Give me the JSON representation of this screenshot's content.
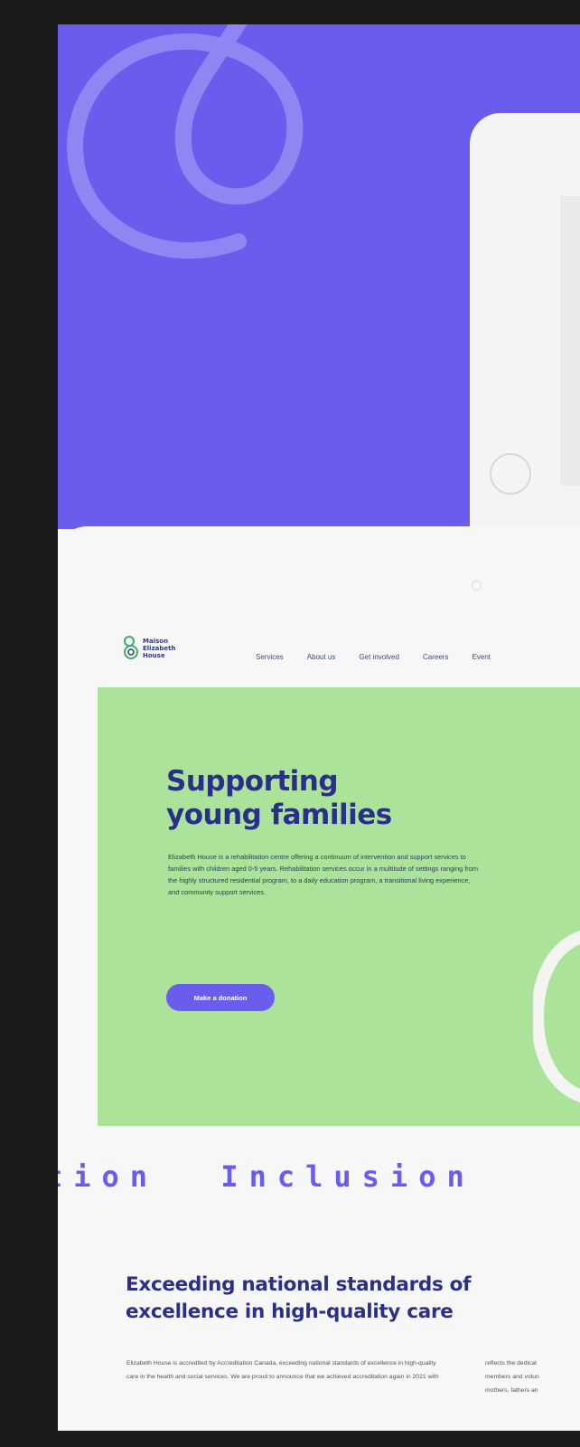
{
  "brand": {
    "name_lines": [
      "Maison",
      "Elizabeth",
      "House"
    ],
    "primary_color": "#6a5ced",
    "accent_color": "#abe39b",
    "heading_color": "#2a2f8a"
  },
  "nav": {
    "items": [
      "Services",
      "About us",
      "Get involved",
      "Careers",
      "Event"
    ]
  },
  "hero": {
    "title_line1": "Supporting",
    "title_line2": "young families",
    "description": "Elizabeth House is a rehabilitation centre offering a continuum of intervention and support services to families with children aged 0-5 years. Rehabilitation services occur in a multitude of settings ranging from the highly structured residential program, to a daily education program, a transitional living experience, and community support services.",
    "cta_label": "Make a donation"
  },
  "ticker": {
    "words": [
      "tion",
      "Inclusion"
    ]
  },
  "standards": {
    "title_line1": "Exceeding national standards of",
    "title_line2": "excellence in high-quality care",
    "paragraph_col1": "Elizabeth House is accredited by Accreditation Canada, exceeding national standards of excellence in high-quality care in the health and social services. We are proud to announce that we achieved accreditation again in 2021 with",
    "paragraph_col2_lines": [
      "reflects the dedicat",
      "members and volun",
      "mothers, fathers an"
    ]
  }
}
